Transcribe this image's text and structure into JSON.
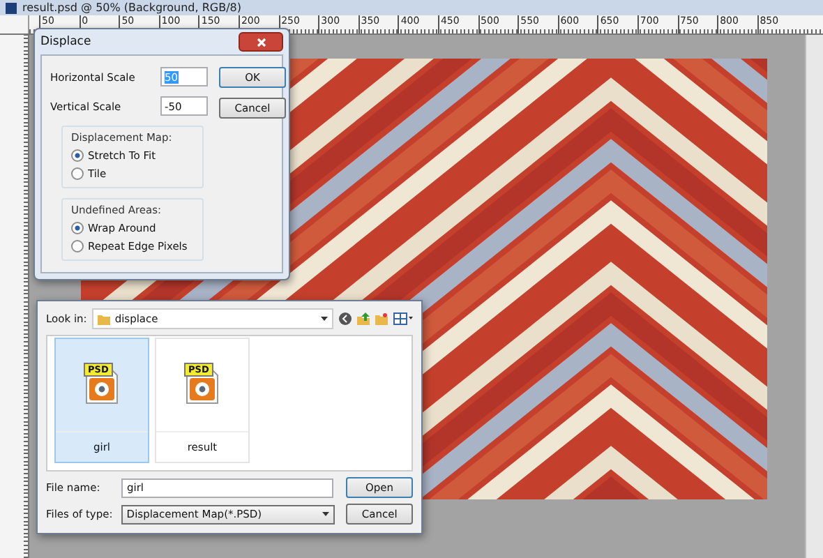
{
  "window": {
    "title": "result.psd @ 50% (Background, RGB/8)"
  },
  "ruler": {
    "labels": [
      "50",
      "0",
      "50",
      "100",
      "150",
      "200",
      "250",
      "300",
      "350",
      "400",
      "450",
      "500",
      "550",
      "600",
      "650",
      "700",
      "750",
      "800",
      "850"
    ]
  },
  "displace_dialog": {
    "title": "Displace",
    "fields": [
      {
        "label": "Horizontal Scale",
        "value": "50",
        "selected": true
      },
      {
        "label": "Vertical Scale",
        "value": "-50",
        "selected": false
      }
    ],
    "buttons": [
      "OK",
      "Cancel"
    ],
    "groups": [
      {
        "title": "Displacement Map:",
        "options": [
          {
            "label": "Stretch To Fit",
            "selected": true
          },
          {
            "label": "Tile",
            "selected": false
          }
        ]
      },
      {
        "title": "Undefined Areas:",
        "options": [
          {
            "label": "Wrap Around",
            "selected": true
          },
          {
            "label": "Repeat Edge Pixels",
            "selected": false
          }
        ]
      }
    ]
  },
  "file_dialog": {
    "look_in_label": "Look in:",
    "look_in": "displace",
    "files": [
      {
        "name": "girl",
        "badge": "PSD",
        "selected": true
      },
      {
        "name": "result",
        "badge": "PSD",
        "selected": false
      }
    ],
    "file_name_label": "File name:",
    "file_name": "girl",
    "file_type_label": "Files of type:",
    "file_type": "Displacement Map(*.PSD)",
    "buttons": [
      "Open",
      "Cancel"
    ]
  }
}
